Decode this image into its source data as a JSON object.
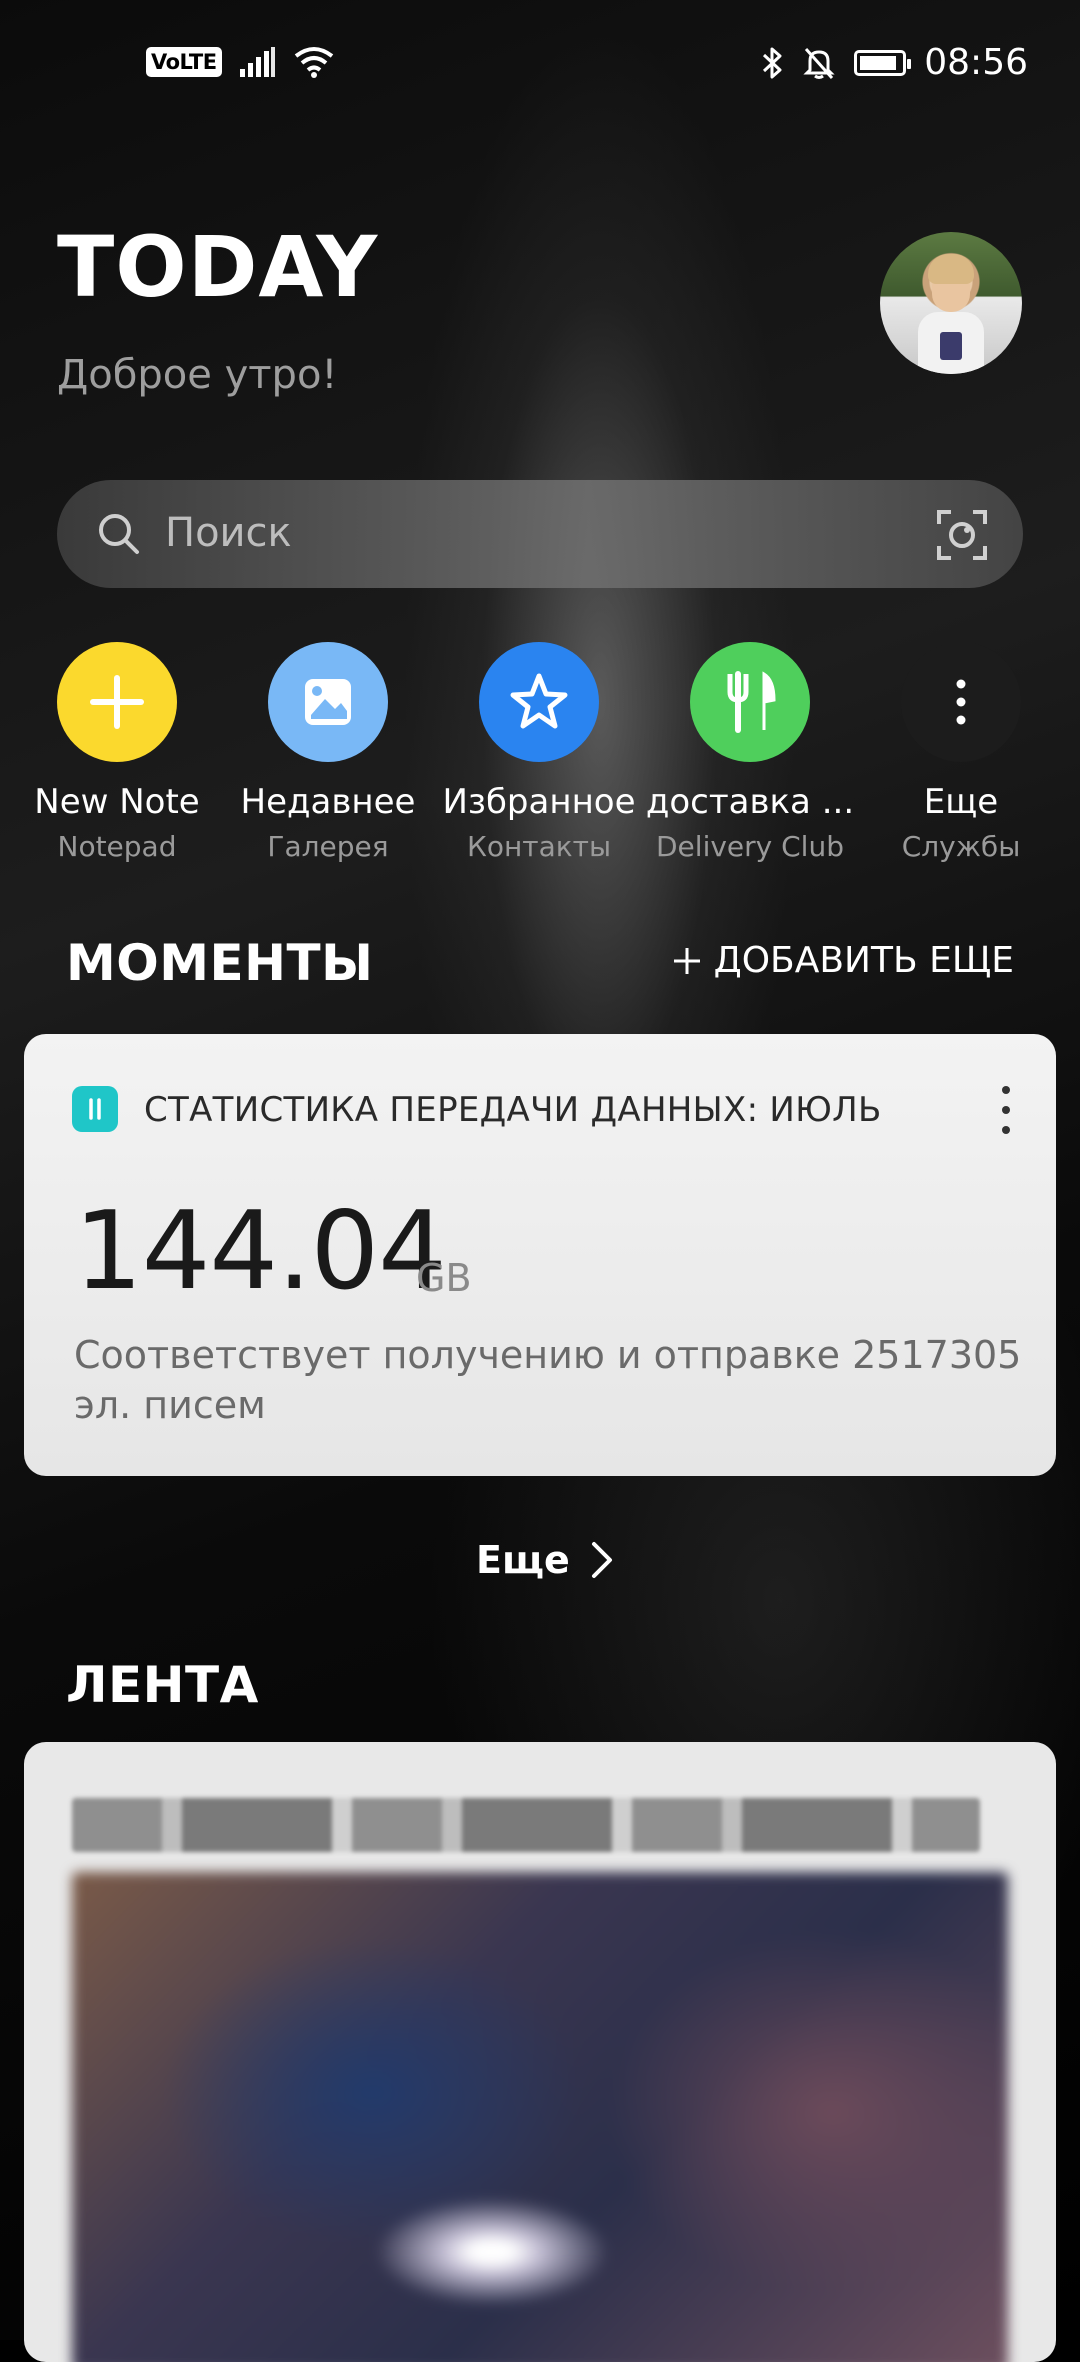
{
  "status_bar": {
    "volte_label": "VoLTE",
    "time": "08:56",
    "battery_level": 0.9
  },
  "header": {
    "title": "TODAY",
    "greeting": "Доброе утро!"
  },
  "search": {
    "placeholder": "Поиск"
  },
  "shortcuts": [
    {
      "label": "New Note",
      "sublabel": "Notepad",
      "color": "#fbd92d",
      "icon": "plus-icon"
    },
    {
      "label": "Недавнее",
      "sublabel": "Галерея",
      "color": "#79b8f6",
      "icon": "gallery-icon"
    },
    {
      "label": "Избранное",
      "sublabel": "Контакты",
      "color": "#2a84f0",
      "icon": "star-icon"
    },
    {
      "label": "доставка ...",
      "sublabel": "Delivery Club",
      "color": "#4fcf5c",
      "icon": "fork-knife-icon"
    },
    {
      "label": "Еще",
      "sublabel": "Службы",
      "color": "#1c1c1c",
      "icon": "more-vertical-icon"
    }
  ],
  "moments": {
    "title": "МОМЕНТЫ",
    "add_more_label": "ДОБАВИТЬ ЕЩЕ",
    "card": {
      "title": "СТАТИСТИКА ПЕРЕДАЧИ ДАННЫХ: ИЮЛЬ",
      "value": "144.04",
      "unit": "GB",
      "description": "Соответствует получению и отправке 2517305 эл. писем"
    },
    "more_label": "Еще"
  },
  "feed": {
    "title": "ЛЕНТА"
  },
  "colors": {
    "card_icon": "#1fc6c8"
  }
}
